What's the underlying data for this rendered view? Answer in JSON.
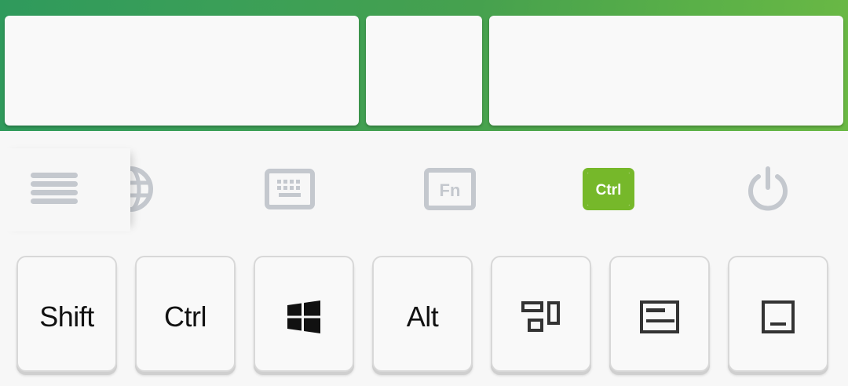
{
  "header": {
    "gradient_colors": [
      "#2f9a5c",
      "#46a14e",
      "#6bb944"
    ],
    "panels": [
      {
        "name": "panel-left",
        "text": ""
      },
      {
        "name": "panel-mid",
        "text": ""
      },
      {
        "name": "panel-right",
        "text": ""
      }
    ]
  },
  "toolbar": {
    "items": [
      {
        "icon": "menu-icon",
        "active": false
      },
      {
        "icon": "globe-icon",
        "active": false
      },
      {
        "icon": "keyboard-icon",
        "active": false
      },
      {
        "icon": "fn-key-icon",
        "label": "Fn",
        "active": false
      },
      {
        "icon": "ctrl-key-icon",
        "label": "Ctrl",
        "active": true
      },
      {
        "icon": "power-icon",
        "active": false
      }
    ],
    "inactive_color": "#c4c8ce",
    "active_color": "#76b82a"
  },
  "keys": {
    "shift_label": "Shift",
    "ctrl_label": "Ctrl",
    "windows_icon": "windows-logo-icon",
    "alt_label": "Alt",
    "task_view_icon": "task-view-icon",
    "window_icon": "window-icon",
    "minimize_icon": "minimize-window-icon"
  }
}
